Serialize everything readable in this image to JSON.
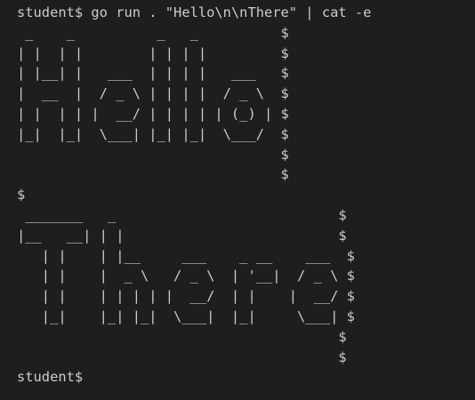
{
  "terminal": {
    "lines": [
      "student$ go run . \"Hello\\n\\nThere\" | cat -e",
      " _    _          _   _          $",
      "| |  | |        | | | |         $",
      "| |__| |   ___  | | | |   ___   $",
      "|  __  |  / _ \\ | | | |  / _ \\  $",
      "| |  | | |  __/ | | | | | (_) | $",
      "|_|  |_|  \\___| |_| |_|  \\___/  $",
      "                                $",
      "                                $",
      "$",
      " _______   _                           $",
      "|__   __| | |                          $",
      "   | |    | |__     ___    _ __    ___  $",
      "   | |    |  _ \\   / _ \\  | '__|  / _ \\ $",
      "   | |    | | | | |  __/  | |    |  __/ $",
      "   |_|    |_| |_|  \\___|  |_|     \\___| $",
      "                                       $",
      "                                       $",
      "student$"
    ]
  }
}
